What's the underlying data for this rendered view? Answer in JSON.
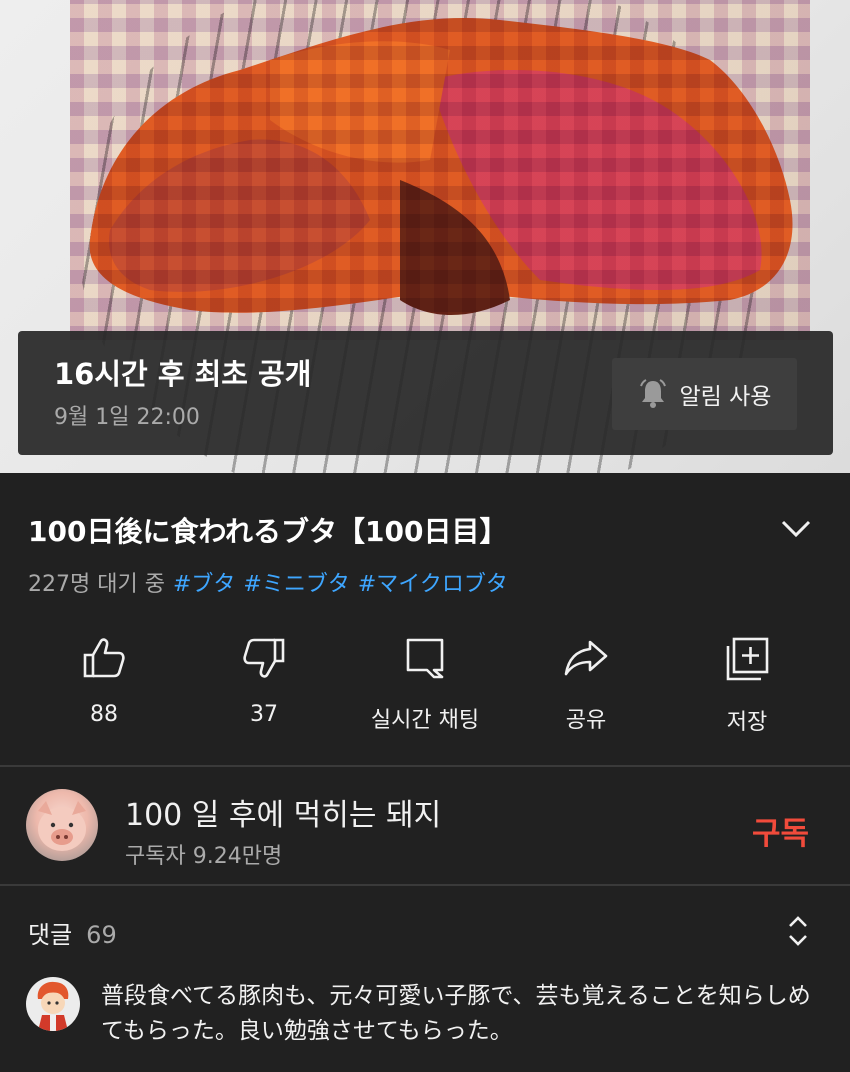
{
  "thumbnail": {
    "premiere_title": "16시간 후 최초 공개",
    "premiere_time": "9월 1일 22:00",
    "notify_label": "알림 사용"
  },
  "video": {
    "title": "100日後に食われるブタ【100日目】",
    "waiting": "227명 대기 중",
    "hashtags": [
      "#ブタ",
      "#ミニブタ",
      "#マイクロブタ"
    ]
  },
  "actions": {
    "like": "88",
    "dislike": "37",
    "live_chat": "실시간 채팅",
    "share": "공유",
    "save": "저장"
  },
  "channel": {
    "name": "100 일 후에 먹히는 돼지",
    "subscribers": "구독자 9.24만명",
    "subscribe_label": "구독"
  },
  "comments": {
    "label": "댓글",
    "count": "69",
    "first": {
      "text": "普段食べてる豚肉も、元々可愛い子豚で、芸も覚えることを知らしめてもらった。良い勉強させてもらった。"
    }
  },
  "colors": {
    "background": "#212121",
    "hashtag": "#3ea6ff",
    "subscribe": "#f14b3b",
    "secondary_text": "#aaaaaa"
  }
}
